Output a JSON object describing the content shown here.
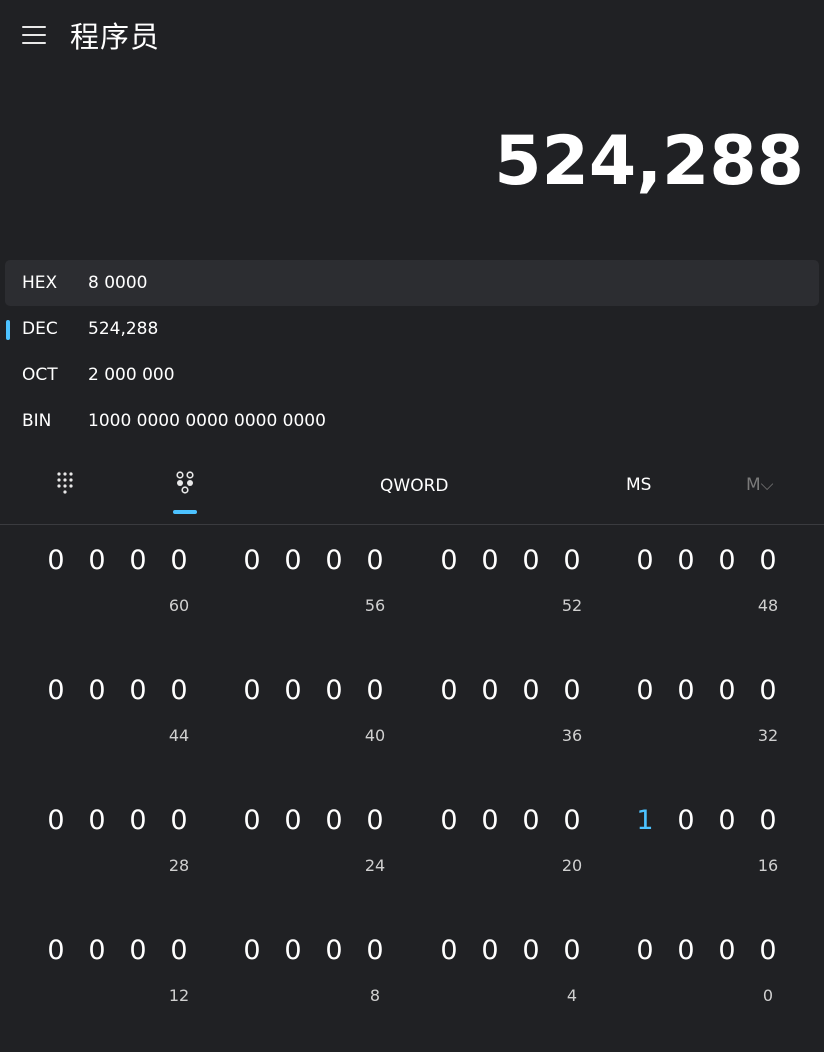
{
  "header": {
    "title": "程序员"
  },
  "display": {
    "value": "524,288"
  },
  "radix": [
    {
      "label": "HEX",
      "value": "8 0000"
    },
    {
      "label": "DEC",
      "value": "524,288"
    },
    {
      "label": "OCT",
      "value": "2 000 000"
    },
    {
      "label": "BIN",
      "value": "1000 0000 0000 0000 0000"
    }
  ],
  "toolbar": {
    "word_size": "QWORD",
    "memory_store": "MS",
    "memory_dropdown": "M⌵"
  },
  "colors": {
    "accent": "#4cc2ff",
    "background": "#202124"
  },
  "icons": [
    "menu-icon",
    "full-keypad-icon",
    "bit-toggle-keypad-icon",
    "chevron-down-icon"
  ],
  "bit_groups": [
    {
      "position_label": "60",
      "bits": [
        "0",
        "0",
        "0",
        "0"
      ]
    },
    {
      "position_label": "56",
      "bits": [
        "0",
        "0",
        "0",
        "0"
      ]
    },
    {
      "position_label": "52",
      "bits": [
        "0",
        "0",
        "0",
        "0"
      ]
    },
    {
      "position_label": "48",
      "bits": [
        "0",
        "0",
        "0",
        "0"
      ]
    },
    {
      "position_label": "44",
      "bits": [
        "0",
        "0",
        "0",
        "0"
      ]
    },
    {
      "position_label": "40",
      "bits": [
        "0",
        "0",
        "0",
        "0"
      ]
    },
    {
      "position_label": "36",
      "bits": [
        "0",
        "0",
        "0",
        "0"
      ]
    },
    {
      "position_label": "32",
      "bits": [
        "0",
        "0",
        "0",
        "0"
      ]
    },
    {
      "position_label": "28",
      "bits": [
        "0",
        "0",
        "0",
        "0"
      ]
    },
    {
      "position_label": "24",
      "bits": [
        "0",
        "0",
        "0",
        "0"
      ]
    },
    {
      "position_label": "20",
      "bits": [
        "0",
        "0",
        "0",
        "0"
      ]
    },
    {
      "position_label": "16",
      "bits": [
        "1",
        "0",
        "0",
        "0"
      ]
    },
    {
      "position_label": "12",
      "bits": [
        "0",
        "0",
        "0",
        "0"
      ]
    },
    {
      "position_label": "8",
      "bits": [
        "0",
        "0",
        "0",
        "0"
      ]
    },
    {
      "position_label": "4",
      "bits": [
        "0",
        "0",
        "0",
        "0"
      ]
    },
    {
      "position_label": "0",
      "bits": [
        "0",
        "0",
        "0",
        "0"
      ]
    }
  ]
}
